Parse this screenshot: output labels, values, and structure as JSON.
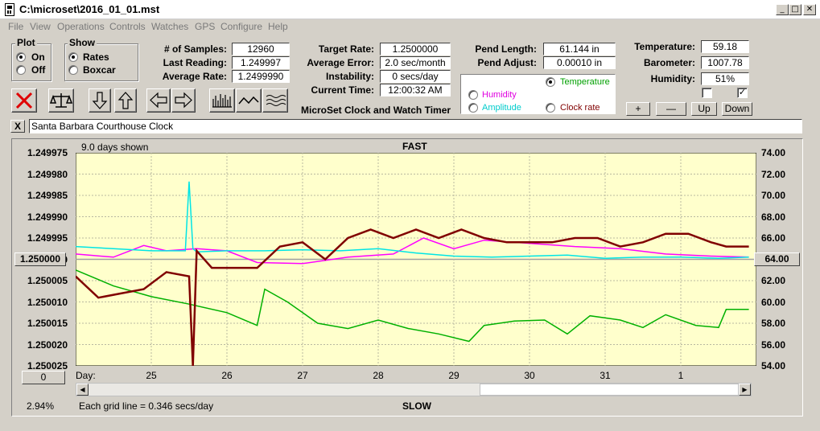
{
  "window": {
    "title": "C:\\microset\\2016_01_01.mst"
  },
  "menu": [
    "File",
    "View",
    "Operations",
    "Controls",
    "Watches",
    "GPS",
    "Configure",
    "Help"
  ],
  "plot_group": {
    "title": "Plot",
    "on": "On",
    "off": "Off",
    "selected": "On"
  },
  "show_group": {
    "title": "Show",
    "rates": "Rates",
    "boxcar": "Boxcar",
    "selected": "Rates"
  },
  "stats": {
    "samples_label": "# of Samples:",
    "samples": "12960",
    "last_reading_label": "Last Reading:",
    "last_reading": "1.249997",
    "average_rate_label": "Average Rate:",
    "average_rate": "1.2499990",
    "target_rate_label": "Target Rate:",
    "target_rate": "1.2500000",
    "average_error_label": "Average Error:",
    "average_error": "2.0 sec/month",
    "instability_label": "Instability:",
    "instability": "0 secs/day",
    "current_time_label": "Current Time:",
    "current_time": "12:00:32 AM",
    "app_name": "MicroSet Clock and Watch Timer",
    "pend_length_label": "Pend Length:",
    "pend_length": "61.144 in",
    "pend_adjust_label": "Pend Adjust:",
    "pend_adjust": "0.00010 in",
    "temperature_label": "Temperature:",
    "temperature": "59.18",
    "barometer_label": "Barometer:",
    "barometer": "1007.78",
    "humidity_label": "Humidity:",
    "humidity": "51%"
  },
  "overlay": {
    "temperature": "Temperature",
    "humidity": "Humidity",
    "amplitude": "Amplitude",
    "clock_rate": "Clock rate",
    "selected": "Temperature"
  },
  "scale_buttons": {
    "plus": "+",
    "minus": "—",
    "up": "Up",
    "down": "Down"
  },
  "checkboxes": {
    "left": false,
    "right": true
  },
  "clock_name": "Santa Barbara Courthouse Clock",
  "clear_label": "X",
  "plot": {
    "days_shown": "9.0 days shown",
    "fast": "FAST",
    "slow": "SLOW",
    "ref_left": "1.250000",
    "ref_right": "64.00",
    "offset_box": "0",
    "percent": "2.94%",
    "grid_note": "Each grid line = 0.346 secs/day",
    "day_label": "Day:"
  },
  "colors": {
    "plot_bg": "#ffffcc",
    "rate": "#800000",
    "temperature": "#00b000",
    "humidity": "#ff00ff",
    "amplitude": "#00e5e5"
  },
  "chart_data": {
    "type": "line",
    "ylabel_left_ticks": [
      "1.249975",
      "1.249980",
      "1.249985",
      "1.249990",
      "1.249995",
      "1.250000",
      "1.250005",
      "1.250010",
      "1.250015",
      "1.250020",
      "1.250025"
    ],
    "ylabel_right_ticks": [
      "74.00",
      "72.00",
      "70.00",
      "68.00",
      "66.00",
      "64.00",
      "62.00",
      "60.00",
      "58.00",
      "56.00",
      "54.00"
    ],
    "ylim_left": [
      1.250025,
      1.249975
    ],
    "ylim_right": [
      54,
      74
    ],
    "xlim": [
      24.0,
      33.0
    ],
    "x_ticks": [
      {
        "v": 25,
        "label": "25"
      },
      {
        "v": 26,
        "label": "26"
      },
      {
        "v": 27,
        "label": "27"
      },
      {
        "v": 28,
        "label": "28"
      },
      {
        "v": 29,
        "label": "29"
      },
      {
        "v": 30,
        "label": "30"
      },
      {
        "v": 31,
        "label": "31"
      },
      {
        "v": 32,
        "label": "1"
      }
    ],
    "series": [
      {
        "key": "rate",
        "axis": "left",
        "x": [
          24.0,
          24.3,
          24.6,
          24.9,
          25.2,
          25.5,
          25.55,
          25.6,
          25.8,
          26.1,
          26.4,
          26.7,
          27.0,
          27.3,
          27.6,
          27.9,
          28.2,
          28.5,
          28.8,
          29.1,
          29.4,
          29.7,
          30.0,
          30.3,
          30.6,
          30.9,
          31.2,
          31.5,
          31.8,
          32.1,
          32.4,
          32.6,
          32.9
        ],
        "values": [
          1.250004,
          1.250009,
          1.250008,
          1.250007,
          1.250003,
          1.250004,
          1.250025,
          1.249998,
          1.250002,
          1.250002,
          1.250002,
          1.249997,
          1.249996,
          1.25,
          1.249995,
          1.249993,
          1.249995,
          1.249993,
          1.249995,
          1.249993,
          1.249995,
          1.249996,
          1.249996,
          1.249996,
          1.249995,
          1.249995,
          1.249997,
          1.249996,
          1.249994,
          1.249994,
          1.249996,
          1.249997,
          1.249997
        ]
      },
      {
        "key": "temperature",
        "axis": "right",
        "x": [
          24.0,
          24.5,
          25.0,
          25.5,
          26.0,
          26.4,
          26.5,
          26.8,
          27.2,
          27.6,
          28.0,
          28.4,
          28.8,
          29.2,
          29.4,
          29.8,
          30.2,
          30.5,
          30.8,
          31.2,
          31.5,
          31.8,
          32.2,
          32.5,
          32.6,
          32.9
        ],
        "values": [
          63.0,
          61.5,
          60.5,
          59.8,
          59.0,
          57.8,
          61.2,
          60.0,
          58.0,
          57.5,
          58.3,
          57.5,
          57.0,
          56.3,
          57.8,
          58.2,
          58.3,
          57.0,
          58.7,
          58.3,
          57.6,
          58.8,
          57.8,
          57.6,
          59.3,
          59.3
        ]
      },
      {
        "key": "humidity",
        "axis": "right",
        "x": [
          24.0,
          24.5,
          24.9,
          25.2,
          25.6,
          26.0,
          26.4,
          27.0,
          27.6,
          28.2,
          28.6,
          29.0,
          29.4,
          30.0,
          30.6,
          31.2,
          31.8,
          32.4,
          32.9
        ],
        "values": [
          64.5,
          64.2,
          65.3,
          64.8,
          65.0,
          64.8,
          63.7,
          63.6,
          64.2,
          64.5,
          66.0,
          65.0,
          65.8,
          65.5,
          65.2,
          65.0,
          64.5,
          64.3,
          64.2
        ]
      },
      {
        "key": "amplitude",
        "axis": "right",
        "x": [
          24.0,
          24.5,
          25.0,
          25.45,
          25.5,
          25.55,
          25.6,
          26.0,
          26.5,
          27.0,
          27.5,
          28.0,
          28.5,
          29.0,
          29.5,
          30.0,
          30.5,
          31.0,
          31.5,
          32.0,
          32.5,
          32.9
        ],
        "values": [
          65.2,
          65.0,
          64.8,
          64.8,
          71.3,
          65.0,
          64.7,
          64.8,
          64.8,
          64.9,
          64.8,
          65.0,
          64.6,
          64.3,
          64.2,
          64.3,
          64.4,
          64.1,
          64.2,
          64.2,
          64.1,
          64.2
        ]
      }
    ]
  }
}
